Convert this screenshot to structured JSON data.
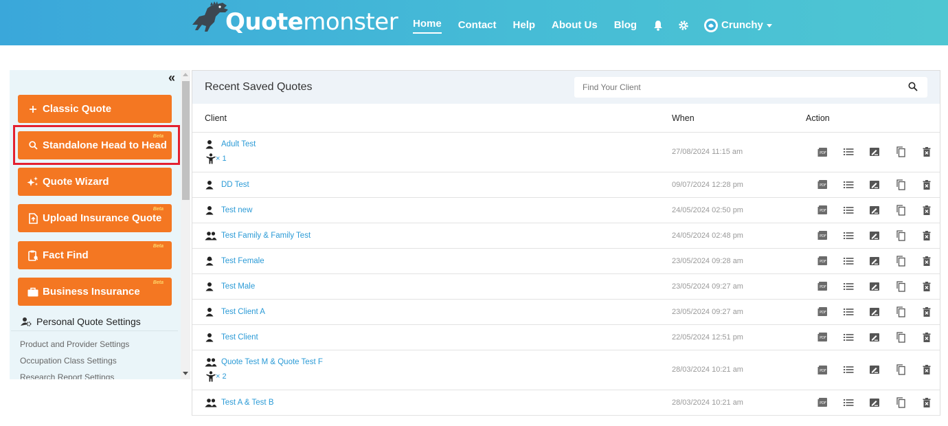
{
  "brand": {
    "name_bold": "Quote",
    "name_light": "monster"
  },
  "nav": {
    "items": [
      {
        "label": "Home",
        "active": true
      },
      {
        "label": "Contact"
      },
      {
        "label": "Help"
      },
      {
        "label": "About Us"
      },
      {
        "label": "Blog"
      }
    ],
    "user_name": "Crunchy"
  },
  "sidebar": {
    "buttons": [
      {
        "label": "Classic Quote",
        "icon": "plus-icon"
      },
      {
        "label": "Standalone Head to Head",
        "icon": "search-icon",
        "badge": "Beta"
      },
      {
        "label": "Quote Wizard",
        "icon": "sparkle-icon"
      },
      {
        "label": "Upload Insurance Quote",
        "icon": "upload-file-icon",
        "badge": "Beta"
      },
      {
        "label": "Fact Find",
        "icon": "clipboard-icon",
        "badge": "Beta"
      },
      {
        "label": "Business Insurance",
        "icon": "briefcase-icon",
        "badge": "Beta"
      }
    ],
    "section_title": "Personal Quote Settings",
    "links": [
      "Product and Provider Settings",
      "Occupation Class Settings",
      "Research Report Settings"
    ]
  },
  "main": {
    "title": "Recent Saved Quotes",
    "search_placeholder": "Find Your Client",
    "columns": {
      "client": "Client",
      "when": "When",
      "action": "Action"
    },
    "rows": [
      {
        "client": "Adult Test",
        "icon": "person",
        "children": "× 1",
        "when": "27/08/2024 11:15 am"
      },
      {
        "client": "DD Test",
        "icon": "person",
        "when": "09/07/2024 12:28 pm"
      },
      {
        "client": "Test new",
        "icon": "person",
        "when": "24/05/2024 02:50 pm"
      },
      {
        "client": "Test Family & Family Test",
        "icon": "couple",
        "when": "24/05/2024 02:48 pm"
      },
      {
        "client": "Test Female",
        "icon": "female",
        "when": "23/05/2024 09:28 am"
      },
      {
        "client": "Test Male",
        "icon": "person",
        "when": "23/05/2024 09:27 am"
      },
      {
        "client": "Test Client A",
        "icon": "person",
        "when": "23/05/2024 09:27 am"
      },
      {
        "client": "Test Client",
        "icon": "person",
        "when": "22/05/2024 12:51 pm"
      },
      {
        "client": "Quote Test M & Quote Test F",
        "icon": "couple",
        "children": "× 2",
        "when": "28/03/2024 10:21 am"
      },
      {
        "client": "Test A & Test B",
        "icon": "couple",
        "when": "28/03/2024 10:21 am"
      }
    ],
    "action_icons": [
      "pdf-icon",
      "list-icon",
      "edit-icon",
      "copy-icon",
      "delete-icon"
    ]
  },
  "colors": {
    "header": "#46bcd6",
    "accent": "#f47722",
    "link": "#2a9ad6",
    "highlight": "#e3202f"
  }
}
